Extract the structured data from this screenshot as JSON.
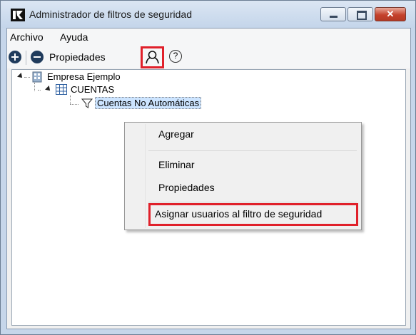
{
  "window": {
    "title": "Administrador de filtros de seguridad",
    "controls": {
      "minimize": "",
      "maximize": "",
      "close": "✕"
    }
  },
  "menubar": {
    "items": [
      "Archivo",
      "Ayuda"
    ]
  },
  "toolbar": {
    "add_icon": "plus-circle-icon",
    "remove_icon": "minus-circle-icon",
    "properties_label": "Propiedades",
    "user_icon": "user-icon",
    "help_label": "?"
  },
  "tree": {
    "nodes": [
      {
        "label": "Empresa Ejemplo",
        "icon": "building-icon",
        "level": 0,
        "expanded": true
      },
      {
        "label": "CUENTAS",
        "icon": "table-grid-icon",
        "level": 1,
        "expanded": true
      },
      {
        "label": "Cuentas No Automáticas",
        "icon": "filter-icon",
        "level": 2,
        "selected": true
      }
    ]
  },
  "context_menu": {
    "items": [
      {
        "label": "Agregar"
      },
      {
        "label": "Eliminar"
      },
      {
        "label": "Propiedades"
      },
      {
        "label": "Asignar usuarios al filtro de seguridad",
        "highlighted": true
      }
    ]
  },
  "colors": {
    "highlight_border": "#e0202a",
    "icon_dark": "#1f3b5c",
    "selection": "#cce4ff"
  }
}
